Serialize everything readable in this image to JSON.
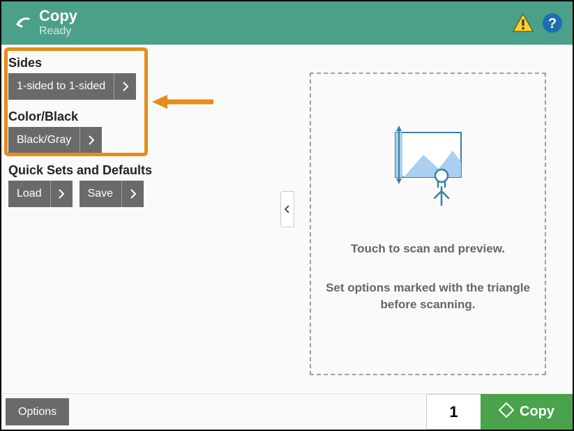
{
  "header": {
    "title": "Copy",
    "status": "Ready"
  },
  "sides": {
    "label": "Sides",
    "value": "1-sided to 1-sided"
  },
  "color": {
    "label": "Color/Black",
    "value": "Black/Gray"
  },
  "quicksets": {
    "label": "Quick Sets and Defaults",
    "load": "Load",
    "save": "Save"
  },
  "preview": {
    "line1": "Touch to scan and preview.",
    "line2": "Set options marked with the triangle before scanning."
  },
  "footer": {
    "options": "Options",
    "copies": "1",
    "copy": "Copy"
  }
}
